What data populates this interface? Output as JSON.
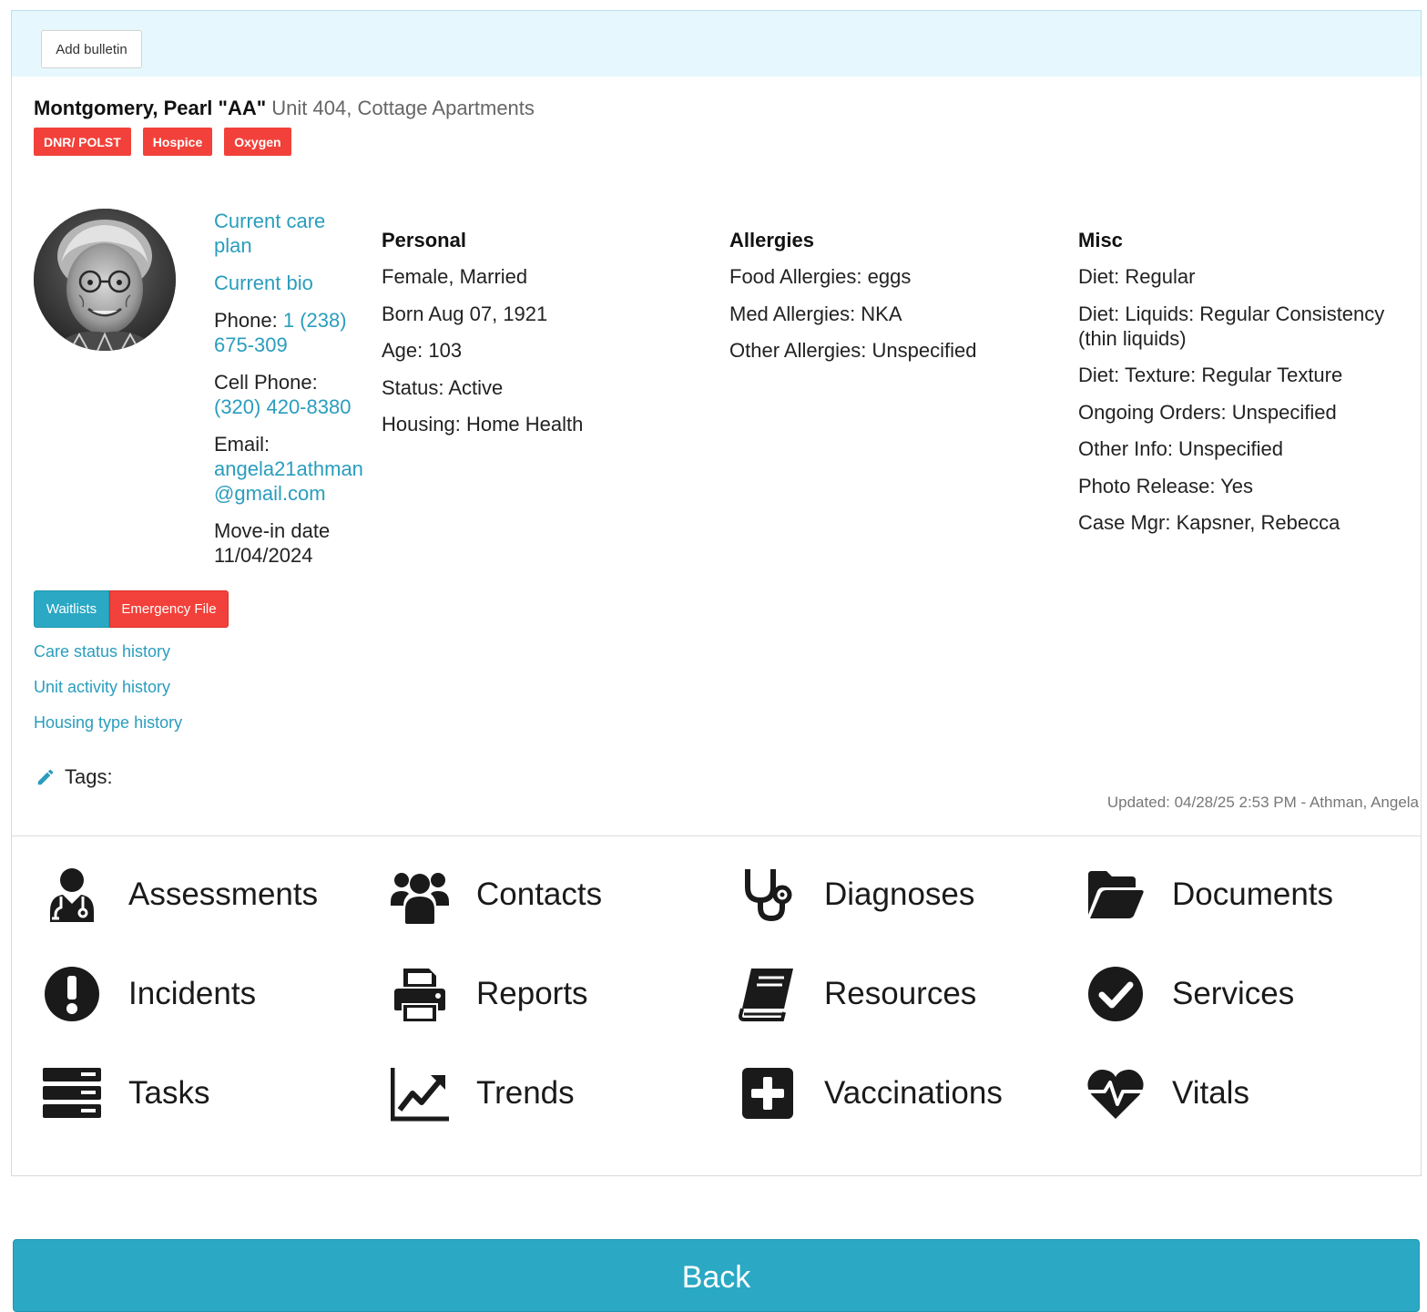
{
  "bulletin": {
    "add_label": "Add bulletin"
  },
  "resident": {
    "name": "Montgomery, Pearl \"AA\"",
    "unit": "Unit 404, Cottage Apartments",
    "badges": [
      "DNR/ POLST",
      "Hospice",
      "Oxygen"
    ]
  },
  "contact": {
    "care_plan_link": "Current care plan",
    "bio_link": "Current bio",
    "phone_label": "Phone:",
    "phone_value": "1 (238) 675-309",
    "cell_label": "Cell Phone:",
    "cell_value": "(320) 420-8380",
    "email_label": "Email:",
    "email_value": "angela21athman@gmail.com",
    "movein_label": "Move-in date",
    "movein_value": "11/04/2024"
  },
  "personal": {
    "heading": "Personal",
    "rows": [
      "Female, Married",
      "Born Aug 07, 1921",
      "Age: 103",
      "Status: Active",
      "Housing: Home Health"
    ]
  },
  "allergies": {
    "heading": "Allergies",
    "rows": [
      "Food Allergies: eggs",
      "Med Allergies: NKA",
      "Other Allergies: Unspecified"
    ]
  },
  "misc": {
    "heading": "Misc",
    "rows": [
      "Diet: Regular",
      "Diet: Liquids: Regular Consistency (thin liquids)",
      "Diet: Texture: Regular Texture",
      "Ongoing Orders: Unspecified",
      "Other Info: Unspecified",
      "Photo Release: Yes",
      "Case Mgr: Kapsner, Rebecca"
    ]
  },
  "actions": {
    "waitlists": "Waitlists",
    "emergency_file": "Emergency File"
  },
  "history": [
    "Care status history",
    "Unit activity history",
    "Housing type history"
  ],
  "tags_label": "Tags:",
  "updated": "Updated: 04/28/25 2:53 PM - Athman, Angela",
  "nav": [
    {
      "label": "Assessments",
      "icon": "user-doctor-icon"
    },
    {
      "label": "Contacts",
      "icon": "users-icon"
    },
    {
      "label": "Diagnoses",
      "icon": "stethoscope-icon"
    },
    {
      "label": "Documents",
      "icon": "folder-open-icon"
    },
    {
      "label": "Incidents",
      "icon": "exclamation-circle-icon"
    },
    {
      "label": "Reports",
      "icon": "print-icon"
    },
    {
      "label": "Resources",
      "icon": "book-icon"
    },
    {
      "label": "Services",
      "icon": "check-circle-icon"
    },
    {
      "label": "Tasks",
      "icon": "server-icon"
    },
    {
      "label": "Trends",
      "icon": "chart-line-icon"
    },
    {
      "label": "Vaccinations",
      "icon": "plus-square-icon"
    },
    {
      "label": "Vitals",
      "icon": "heartbeat-icon"
    }
  ],
  "back_label": "Back",
  "colors": {
    "accent": "#2aa8c4",
    "danger": "#f2413a",
    "link": "#2a9dbd",
    "bulletin_bg": "#e6f8fd"
  }
}
